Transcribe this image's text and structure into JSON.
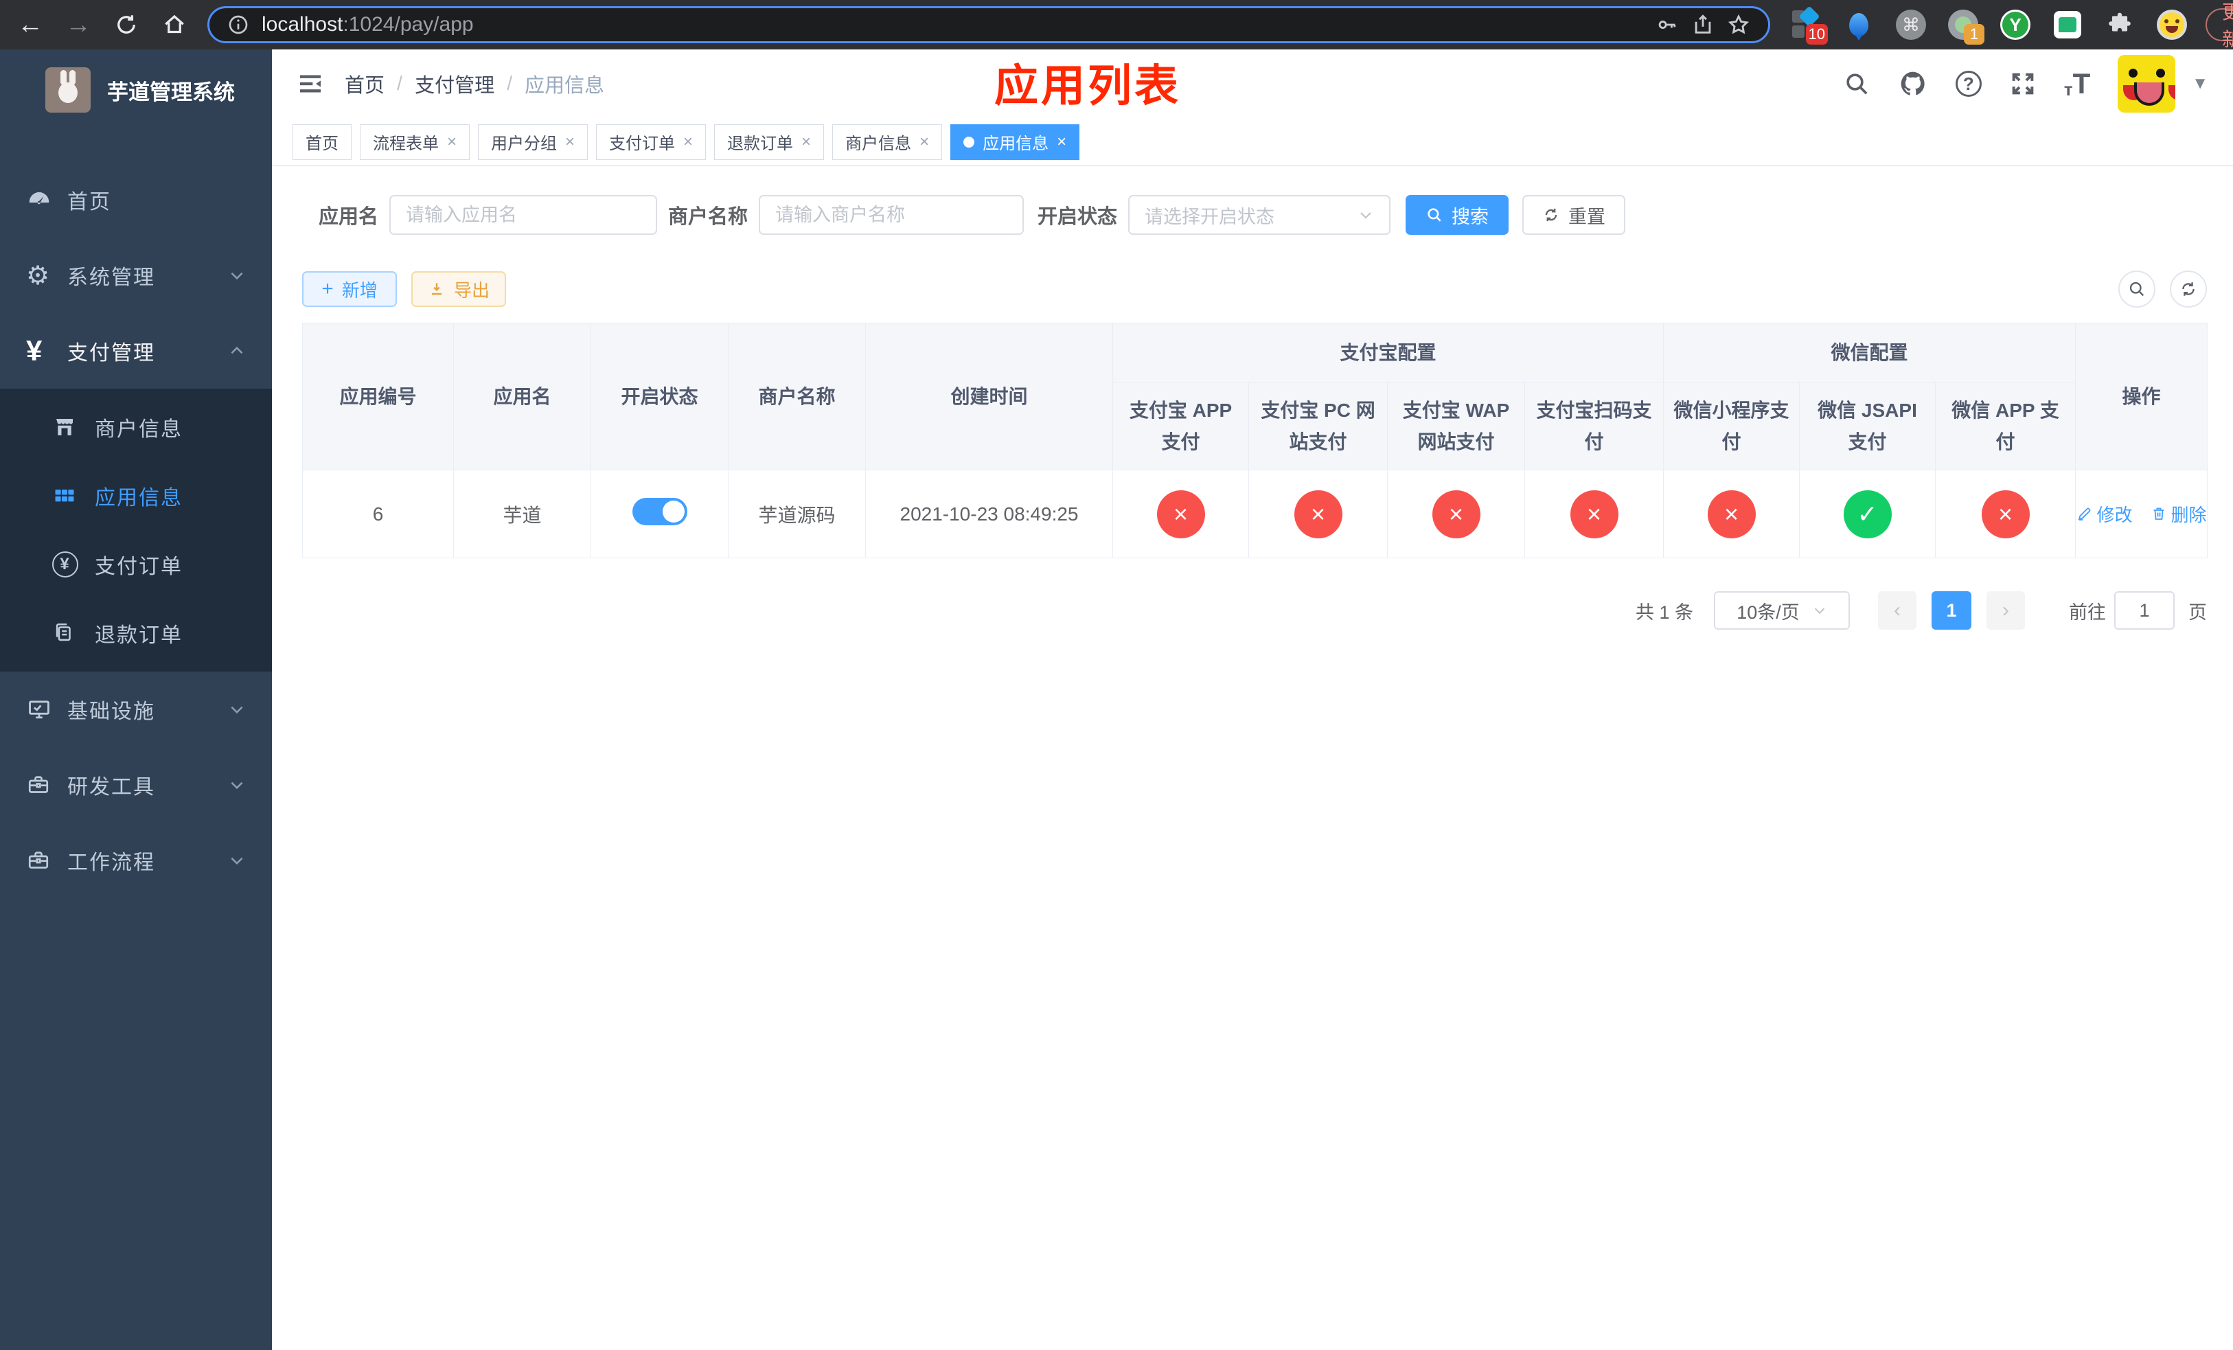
{
  "browser": {
    "url": {
      "host": "localhost",
      "path": ":1024/pay/app"
    },
    "update_label": "更新",
    "extensions": {
      "pin_badge": "10",
      "profile_badge": "1",
      "y_label": "Y"
    }
  },
  "sidebar": {
    "title": "芋道管理系统",
    "menu": [
      {
        "label": "首页"
      },
      {
        "label": "系统管理"
      },
      {
        "label": "支付管理"
      },
      {
        "label": "基础设施"
      },
      {
        "label": "研发工具"
      },
      {
        "label": "工作流程"
      }
    ],
    "submenu": [
      {
        "label": "商户信息"
      },
      {
        "label": "应用信息"
      },
      {
        "label": "支付订单"
      },
      {
        "label": "退款订单"
      }
    ]
  },
  "header": {
    "breadcrumb": [
      "首页",
      "支付管理",
      "应用信息"
    ],
    "overlay_title": "应用列表"
  },
  "tabs": [
    {
      "label": "首页"
    },
    {
      "label": "流程表单"
    },
    {
      "label": "用户分组"
    },
    {
      "label": "支付订单"
    },
    {
      "label": "退款订单"
    },
    {
      "label": "商户信息"
    },
    {
      "label": "应用信息"
    }
  ],
  "filters": {
    "app_name": {
      "label": "应用名",
      "placeholder": "请输入应用名",
      "value": ""
    },
    "merchant_name": {
      "label": "商户名称",
      "placeholder": "请输入商户名称",
      "value": ""
    },
    "status": {
      "label": "开启状态",
      "placeholder": "请选择开启状态"
    },
    "search_label": "搜索",
    "reset_label": "重置"
  },
  "toolbar": {
    "add_label": "新增",
    "export_label": "导出"
  },
  "table": {
    "headers": {
      "id": "应用编号",
      "name": "应用名",
      "status": "开启状态",
      "merchant": "商户名称",
      "created": "创建时间",
      "alipay_group": "支付宝配置",
      "wechat_group": "微信配置",
      "alipay_cols": [
        "支付宝 APP 支付",
        "支付宝 PC 网站支付",
        "支付宝 WAP 网站支付",
        "支付宝扫码支付"
      ],
      "wechat_cols": [
        "微信小程序支付",
        "微信 JSAPI 支付",
        "微信 APP 支付"
      ],
      "actions": "操作"
    },
    "rows": [
      {
        "id": "6",
        "name": "芋道",
        "enabled": true,
        "merchant": "芋道源码",
        "created": "2021-10-23 08:49:25",
        "alipay": [
          false,
          false,
          false,
          false
        ],
        "wechat": [
          false,
          true,
          false
        ],
        "edit_label": "修改",
        "delete_label": "删除"
      }
    ]
  },
  "pagination": {
    "total": "共 1 条",
    "page_size": "10条/页",
    "current": "1",
    "goto_label": "前往",
    "goto_value": "1",
    "page_suffix": "页"
  },
  "colors": {
    "primary": "#409eff",
    "success": "#13ce66",
    "danger": "#f8514c",
    "warning": "#e6a23c",
    "sidebar": "#304156"
  }
}
